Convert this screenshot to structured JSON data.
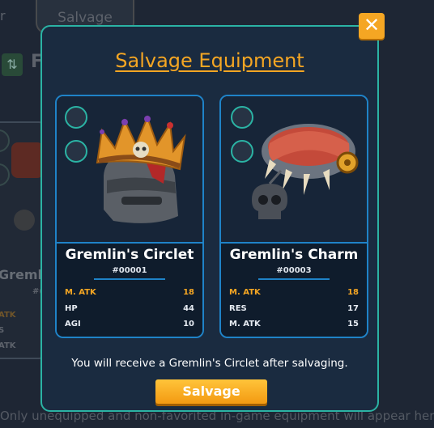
{
  "background": {
    "tab_label": "Salvage",
    "left_fragment": "r",
    "header_fragment": "F",
    "card_name_fragment": "Gremlin",
    "card_id_fragment": "#(",
    "stat_fragments": [
      "ATK",
      "S",
      "ATK"
    ],
    "footer_text": "Only unequipped and non-favorited in-game equipment will appear here"
  },
  "modal": {
    "title": "Salvage Equipment",
    "close_label": "✕",
    "receive_text": "You will receive a Gremlin's Circlet after salvaging.",
    "salvage_button": "Salvage",
    "colors": {
      "accent": "#f5a623",
      "border_teal": "#2bb3a4",
      "border_blue": "#1f83c8",
      "panel": "#1a2b40"
    },
    "cards": [
      {
        "name": "Gremlin's Circlet",
        "id": "#00001",
        "image_icon": "crowned-helmet-icon",
        "stats": [
          {
            "name": "M. ATK",
            "value": "18",
            "highlight": true
          },
          {
            "name": "HP",
            "value": "44",
            "highlight": false
          },
          {
            "name": "AGI",
            "value": "10",
            "highlight": false
          }
        ]
      },
      {
        "name": "Gremlin's Charm",
        "id": "#00003",
        "image_icon": "skull-bracelet-icon",
        "stats": [
          {
            "name": "M. ATK",
            "value": "18",
            "highlight": true
          },
          {
            "name": "RES",
            "value": "17",
            "highlight": false
          },
          {
            "name": "M. ATK",
            "value": "15",
            "highlight": false
          }
        ]
      }
    ]
  }
}
